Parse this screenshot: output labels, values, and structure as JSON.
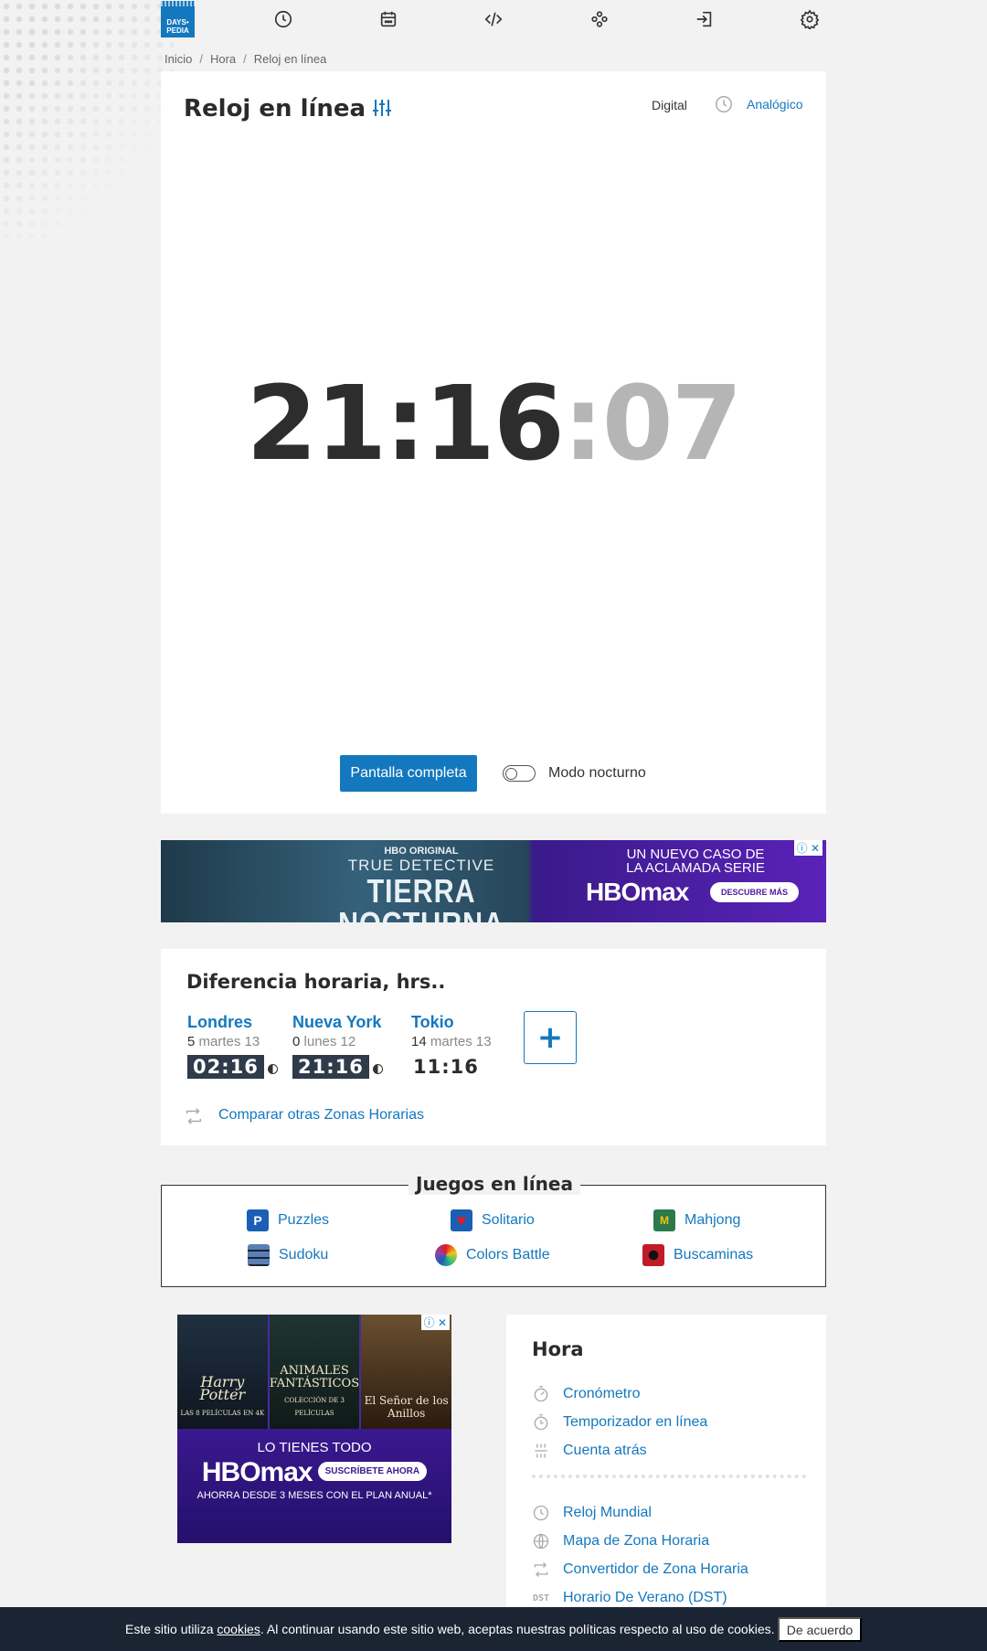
{
  "logo": {
    "line1": "DAYS•",
    "line2": "PEDIA"
  },
  "nav": {
    "icons": [
      "clock-icon",
      "calendar-icon",
      "code-icon",
      "gamepad-icon",
      "login-icon",
      "gear-icon"
    ]
  },
  "breadcrumb": {
    "items": [
      "Inicio",
      "Hora",
      "Reloj en línea"
    ],
    "separator": "/"
  },
  "clock": {
    "title": "Reloj en línea",
    "mode_digital": "Digital",
    "mode_analog": "Analógico",
    "time_hm": "21:16",
    "time_sec": ":07",
    "fullscreen_label": "Pantalla completa",
    "night_mode_label": "Modo nocturno",
    "night_mode_on": false
  },
  "ad_banner": {
    "small": "HBO ORIGINAL",
    "mid": "TRUE DETECTIVE",
    "big": "TIERRA NOCTURNA",
    "right_line1": "UN NUEVO CASO DE",
    "right_line2": "LA ACLAMADA SERIE",
    "brand": "HBOmax",
    "cta": "DESCUBRE MÁS",
    "close": "ⓘ ✕"
  },
  "time_diff": {
    "title": "Diferencia horaria, hrs..",
    "cities": [
      {
        "name": "Londres",
        "offset": "5",
        "day": "martes 13",
        "time": "02:16",
        "night": true
      },
      {
        "name": "Nueva York",
        "offset": "0",
        "day": "lunes 12",
        "time": "21:16",
        "night": true
      },
      {
        "name": "Tokio",
        "offset": "14",
        "day": "martes 13",
        "time": "11:16",
        "night": false
      }
    ],
    "add_label": "+",
    "compare_link": "Comparar otras Zonas Horarias"
  },
  "games": {
    "title": "Juegos en línea",
    "items": [
      {
        "label": "Puzzles",
        "icon": "puzzle-icon",
        "color": "#1a5fb4"
      },
      {
        "label": "Solitario",
        "icon": "heart-card-icon",
        "color": "#e01b24"
      },
      {
        "label": "Mahjong",
        "icon": "mahjong-icon",
        "color": "#c88a2a"
      },
      {
        "label": "Sudoku",
        "icon": "sudoku-grid-icon",
        "color": "#1a2433"
      },
      {
        "label": "Colors Battle",
        "icon": "colors-battle-icon",
        "color": "#e66100"
      },
      {
        "label": "Buscaminas",
        "icon": "mine-icon",
        "color": "#c01c28"
      }
    ]
  },
  "ad_side": {
    "panel1": "Harry Potter",
    "panel1_sub": "LAS 8 PELÍCULAS EN 4K",
    "panel2": "ANIMALES FANTÁSTICOS",
    "panel2_sub": "COLECCIÓN DE 3 PELÍCULAS",
    "panel3": "El Señor de los Anillos",
    "line1": "LO TIENES TODO",
    "brand": "HBOmax",
    "cta": "SUSCRÍBETE AHORA",
    "line2": "AHORRA DESDE 3 MESES CON EL PLAN ANUAL*",
    "close": "ⓘ ✕"
  },
  "hora": {
    "title": "Hora",
    "links": [
      {
        "label": "Cronómetro",
        "icon": "stopwatch-icon"
      },
      {
        "label": "Temporizador en línea",
        "icon": "timer-icon"
      },
      {
        "label": "Cuenta atrás",
        "icon": "countdown-icon"
      },
      {
        "label": "Reloj Mundial",
        "icon": "clock-icon"
      },
      {
        "label": "Mapa de Zona Horaria",
        "icon": "globe-icon"
      },
      {
        "label": "Convertidor de Zona Horaria",
        "icon": "convert-icon"
      },
      {
        "label": "Horario De Verano (DST)",
        "icon": "dst-icon",
        "icon_text": "DST"
      }
    ]
  },
  "cookie": {
    "pre": "Este sitio utiliza ",
    "link": "cookies",
    "post": ". Al continuar usando este sitio web, aceptas nuestras políticas respecto al uso de cookies.",
    "accept": "De acuerdo"
  },
  "colors": {
    "accent": "#1478be",
    "dark": "#1a2433",
    "background": "#f2f2f2"
  }
}
